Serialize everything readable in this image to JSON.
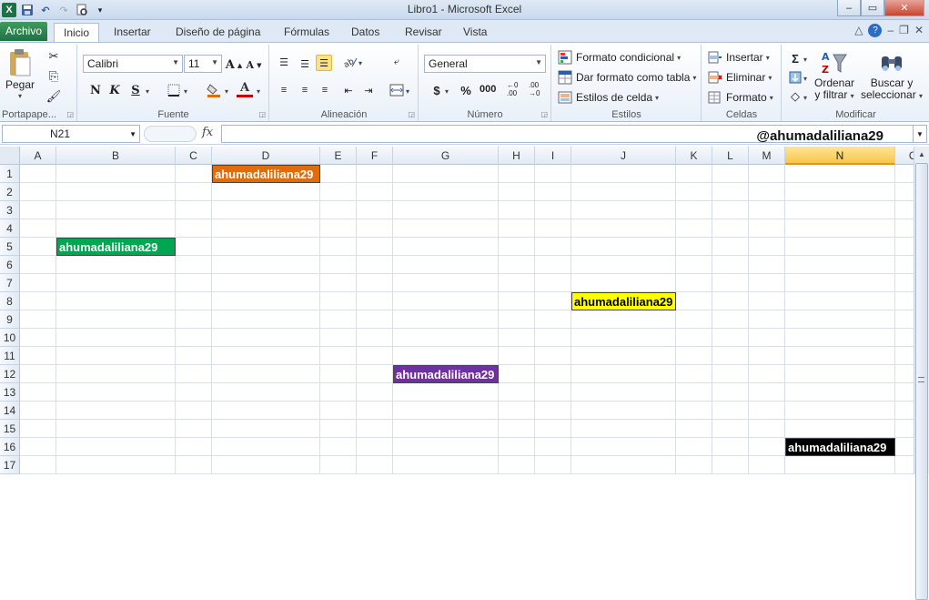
{
  "window": {
    "title": "Libro1 - Microsoft Excel",
    "controls": {
      "minimize": "–",
      "maximize": "▭",
      "close": "✕"
    }
  },
  "qat": {
    "icons": [
      "excel-icon",
      "save-icon",
      "undo-icon",
      "redo-icon",
      "print-preview-icon",
      "customize-icon"
    ]
  },
  "tabs": [
    {
      "label": "Archivo"
    },
    {
      "label": "Inicio"
    },
    {
      "label": "Insertar"
    },
    {
      "label": "Diseño de página"
    },
    {
      "label": "Fórmulas"
    },
    {
      "label": "Datos"
    },
    {
      "label": "Revisar"
    },
    {
      "label": "Vista"
    }
  ],
  "ribbon": {
    "portapapeles": {
      "label": "Portapape...",
      "paste": "Pegar"
    },
    "fuente": {
      "label": "Fuente",
      "font_name": "Calibri",
      "font_size": "11",
      "bold": "N",
      "italic": "K",
      "underline": "S"
    },
    "alineacion": {
      "label": "Alineación"
    },
    "numero": {
      "label": "Número",
      "format": "General",
      "currency": "$",
      "percent": "%",
      "thousands": "000"
    },
    "estilos": {
      "label": "Estilos",
      "conditional": "Formato condicional",
      "as_table": "Dar formato como tabla",
      "cell_styles": "Estilos de celda"
    },
    "celdas": {
      "label": "Celdas",
      "insert": "Insertar",
      "delete": "Eliminar",
      "format": "Formato"
    },
    "modificar": {
      "label": "Modificar",
      "sort": "Ordenar",
      "sort2": "y filtrar",
      "find": "Buscar y",
      "find2": "seleccionar"
    }
  },
  "formula_bar": {
    "name_box": "N21",
    "fx": "fx",
    "content": "@ahumadaliliana29"
  },
  "columns": [
    "A",
    "B",
    "C",
    "D",
    "E",
    "F",
    "G",
    "H",
    "I",
    "J",
    "K",
    "L",
    "M",
    "N",
    "O"
  ],
  "active_column": "N",
  "rows": [
    "1",
    "2",
    "3",
    "4",
    "5",
    "6",
    "7",
    "8",
    "9",
    "10",
    "11",
    "12",
    "13",
    "14",
    "15",
    "16",
    "17"
  ],
  "cells": [
    {
      "ref": "D1",
      "text": "ahumadaliliana29",
      "bg": "#e36c0a",
      "color": "#ffffff"
    },
    {
      "ref": "B5",
      "text": "ahumadaliliana29",
      "bg": "#00a650",
      "color": "#ffffff"
    },
    {
      "ref": "J8",
      "text": "ahumadaliliana29",
      "bg": "#ffff00",
      "color": "#000000"
    },
    {
      "ref": "G12",
      "text": "ahumadaliliana29",
      "bg": "#7030a0",
      "color": "#ffffff"
    },
    {
      "ref": "N16",
      "text": "ahumadaliliana29",
      "bg": "#000000",
      "color": "#ffffff"
    }
  ]
}
